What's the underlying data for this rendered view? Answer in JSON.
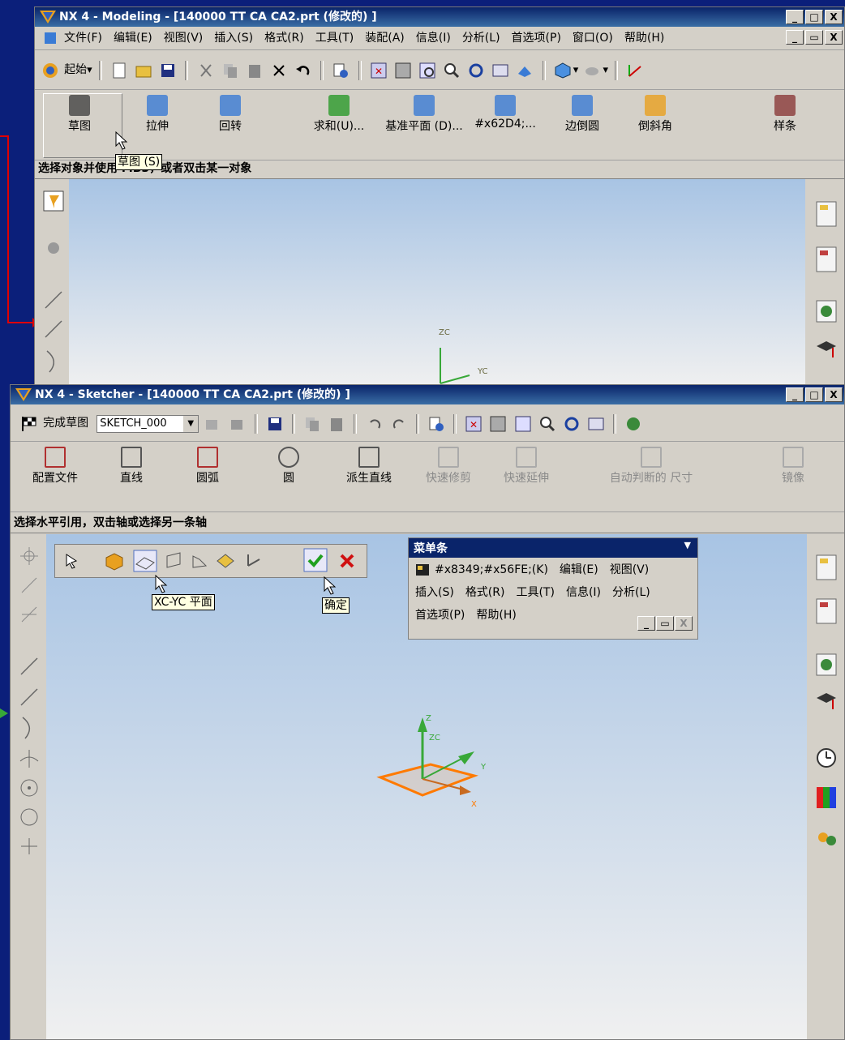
{
  "modeling": {
    "title": "NX 4 - Modeling - [140000 TT CA CA2.prt (修改的) ]",
    "menu": [
      "文件(F)",
      "编辑(E)",
      "视图(V)",
      "插入(S)",
      "格式(R)",
      "工具(T)",
      "装配(A)",
      "信息(I)",
      "分析(L)",
      "首选项(P)",
      "窗口(O)",
      "帮助(H)"
    ],
    "start_label": "起始",
    "tools": [
      "草图",
      "拉伸",
      "回转",
      "求和(U)...",
      "基准平面 (D)...",
      "#x62D4;...",
      "边倒圆",
      "倒斜角",
      "样条"
    ],
    "tooltip": "草图 (S)",
    "status": "选择对象并使用 MB3，或者双击某一对象"
  },
  "sketcher": {
    "title": "NX 4 - Sketcher - [140000 TT CA CA2.prt (修改的) ]",
    "finish_label": "完成草图",
    "sketch_name": "SKETCH_000",
    "tools": [
      "配置文件",
      "直线",
      "圆弧",
      "圆",
      "派生直线",
      "快速修剪",
      "快速延伸",
      "自动判断的 尺寸",
      "镜像"
    ],
    "status": "选择水平引用，双击轴或选择另一条轴",
    "tooltip_plane": "XC-YC 平面",
    "tooltip_ok": "确定",
    "menubar": {
      "title": "菜单条",
      "line1": [
        "#x8349;#x56FE;(K)",
        "编辑(E)",
        "视图(V)"
      ],
      "line2": [
        "插入(S)",
        "格式(R)",
        "工具(T)",
        "信息(I)",
        "分析(L)"
      ],
      "line3": [
        "首选项(P)",
        "帮助(H)"
      ]
    },
    "axis": {
      "z": "Z",
      "zc": "ZC",
      "y": "Y",
      "x": "X"
    }
  },
  "axes_small": {
    "zc": "ZC",
    "yc": "YC"
  },
  "win_btns": {
    "min": "_",
    "max": "□",
    "close": "X",
    "restore": "▭"
  },
  "colors": {
    "title": "#0a246a",
    "accent": "#ff7a00",
    "axis_green": "#38a838",
    "red_arrow": "#e00000"
  }
}
